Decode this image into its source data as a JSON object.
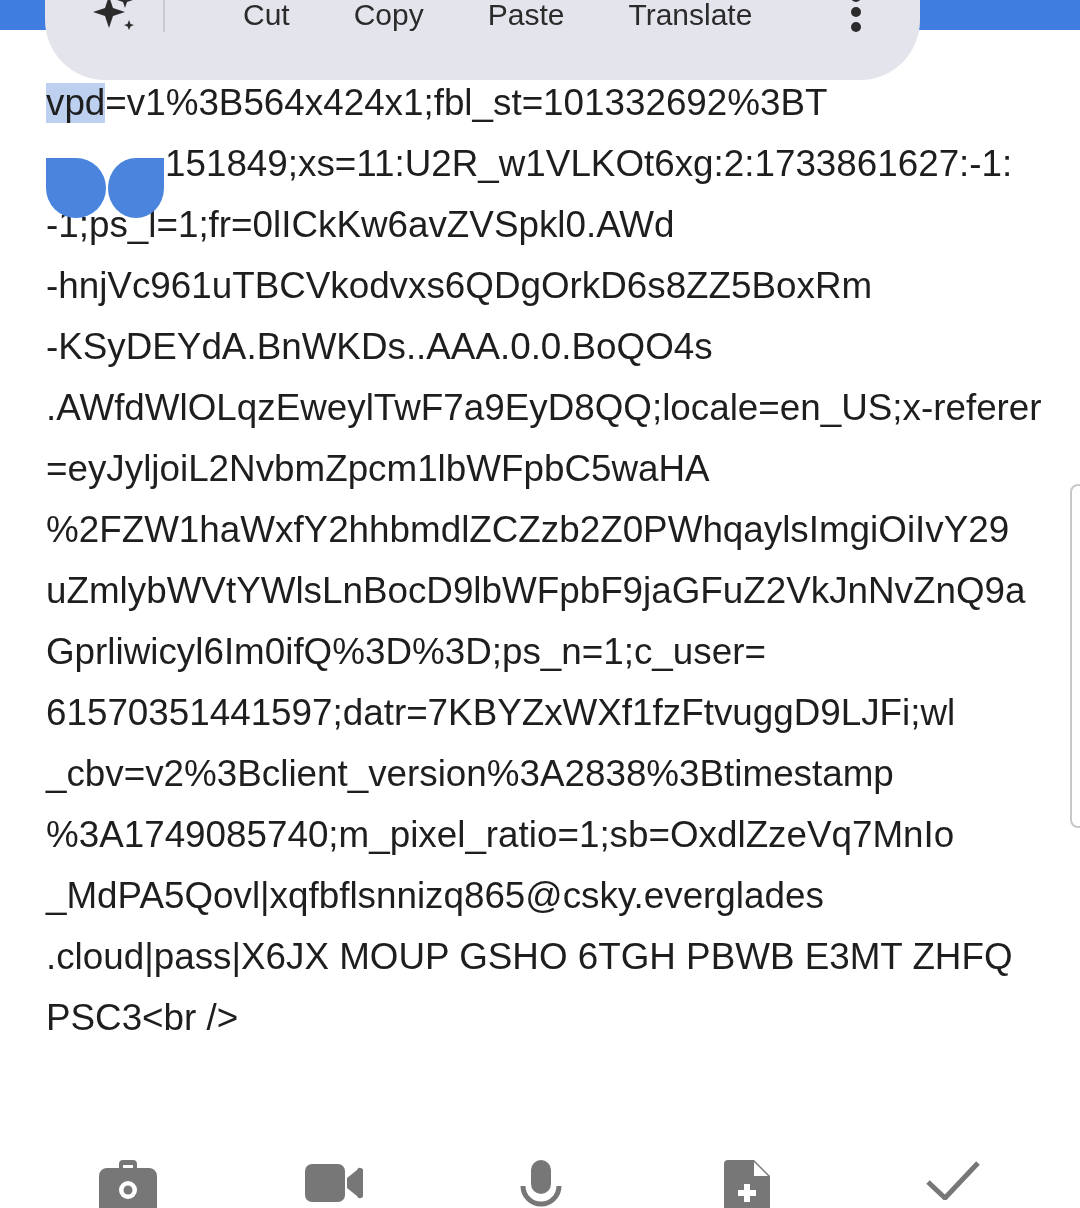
{
  "text_menu": {
    "items": [
      {
        "kind": "icon"
      },
      {
        "kind": "text",
        "label": "Cut"
      },
      {
        "kind": "text",
        "label": "Copy"
      },
      {
        "kind": "text",
        "label": "Paste"
      },
      {
        "kind": "text",
        "label": "Translate"
      },
      {
        "kind": "more"
      }
    ]
  },
  "editor": {
    "lines": [
      {
        "selected_text": "vpd",
        "text": "=v1%3B564x424x1;fbl_st=101332692%3BT",
        "handles_before": false
      },
      {
        "text": "151849;xs=11:U2R_w1VLKOt6xg:2:1733861627:-1:",
        "handles_before": true
      },
      {
        "text": "-1;ps_l=1;fr=0lICkKw6avZVSpkl0.AWd",
        "handles_before": false
      },
      {
        "text": "-hnjVc961uTBCVkodvxs6QDgOrkD6s8ZZ5BoxRm",
        "handles_before": false
      },
      {
        "text": "-KSyDEYdA.BnWKDs..AAA.0.0.BoQO4s",
        "handles_before": false
      },
      {
        "text": ".AWfdWlOLqzEweylTwF7a9EyD8QQ;locale=en_US;x-referer",
        "handles_before": false
      },
      {
        "text": "=eyJyljoiL2NvbmZpcm1lbWFpbC5waHA",
        "handles_before": false
      },
      {
        "text": "%2FZW1haWxfY2hhbmdlZCZzb2Z0PWhqaylsImgiOiIvY29",
        "handles_before": false
      },
      {
        "text": "uZmlybWVtYWlsLnBocD9lbWFpbF9jaGFuZ2VkJnNvZnQ9a",
        "handles_before": false
      },
      {
        "text": "Gprliwicyl6Im0ifQ%3D%3D;ps_n=1;c_user=",
        "handles_before": false
      },
      {
        "text": "61570351441597;datr=7KBYZxWXf1fzFtvuggD9LJFi;wl",
        "handles_before": false
      },
      {
        "text": "_cbv=v2%3Bclient_version%3A2838%3Btimestamp",
        "handles_before": false
      },
      {
        "text": "%3A1749085740;m_pixel_ratio=1;sb=OxdlZzeVq7MnIo",
        "handles_before": false
      },
      {
        "text": "_MdPA5Qovl|xqfbflsnnizq865@csky.everglades",
        "handles_before": false
      },
      {
        "text": ".cloud|pass|X6JX MOUP GSHO 6TGH PBWB E3MT ZHFQ",
        "handles_before": false
      },
      {
        "text": "PSC3<br />",
        "handles_before": false
      }
    ]
  },
  "bottom_toolbar": {
    "tools": [
      {
        "kind": "camera"
      },
      {
        "kind": "video"
      },
      {
        "kind": "mic"
      },
      {
        "kind": "file"
      },
      {
        "kind": "check"
      }
    ]
  }
}
